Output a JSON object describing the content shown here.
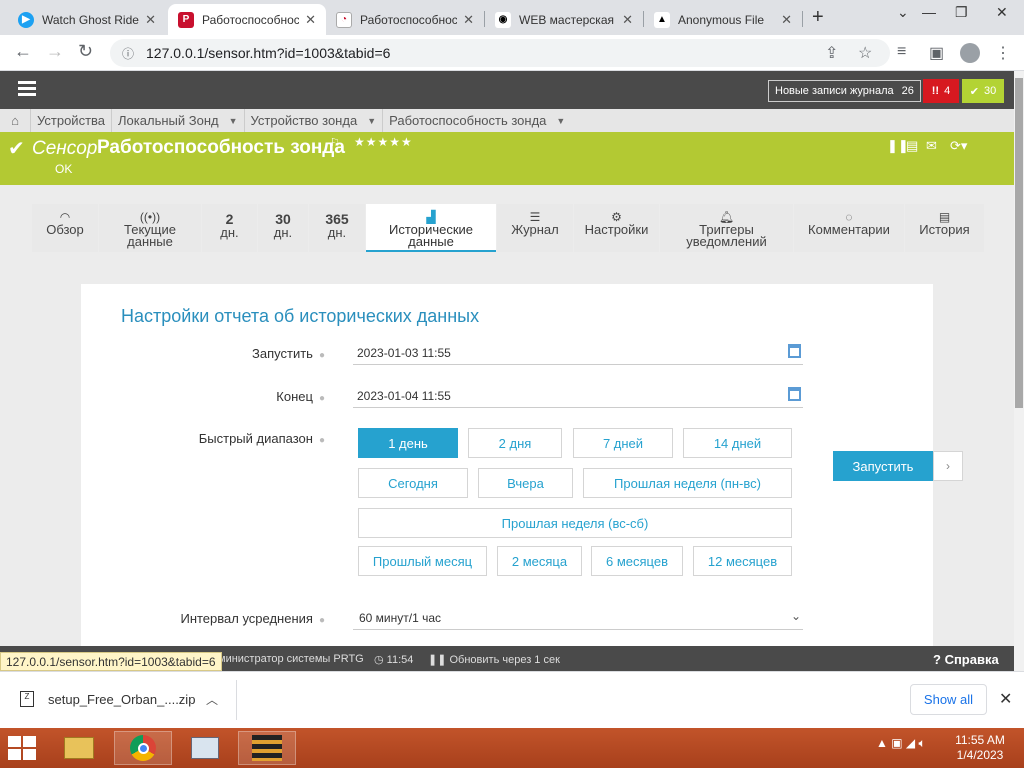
{
  "browser": {
    "tabs": [
      {
        "title": "Watch Ghost Rider",
        "active": false
      },
      {
        "title": "Работоспособность",
        "active": true
      },
      {
        "title": "Работоспособность",
        "active": false
      },
      {
        "title": "WEB мастерская",
        "active": false
      },
      {
        "title": "Anonymous File",
        "active": false
      }
    ],
    "url": "127.0.0.1/sensor.htm?id=1003&tabid=6"
  },
  "prtg": {
    "log_label": "Новые записи журнала",
    "log_count": "26",
    "error_count": "4",
    "ok_count": "30",
    "breadcrumb": [
      "Устройства",
      "Локальный Зонд",
      "Устройство зонда",
      "Работоспособность зонда"
    ],
    "sensor_type": "Сенсор",
    "sensor_name": "Работоспособность зонда",
    "status": "OK",
    "tabs": [
      {
        "label": "Обзор",
        "icon": "gauge-icon"
      },
      {
        "label": "Текущие данные",
        "icon": "live-data-icon"
      },
      {
        "big": "2",
        "label": "дн."
      },
      {
        "big": "30",
        "label": "дн."
      },
      {
        "big": "365",
        "label": "дн."
      },
      {
        "label": "Исторические данные",
        "icon": "chart-icon",
        "active": true
      },
      {
        "label": "Журнал",
        "icon": "log-icon"
      },
      {
        "label": "Настройки",
        "icon": "gear-icon"
      },
      {
        "label": "Триггеры уведомлений",
        "icon": "bell-icon"
      },
      {
        "label": "Комментарии",
        "icon": "comment-icon"
      },
      {
        "label": "История",
        "icon": "history-icon"
      }
    ],
    "report": {
      "title": "Настройки отчета об исторических данных",
      "start_label": "Запустить",
      "start_value": "2023-01-03 11:55",
      "end_label": "Конец",
      "end_value": "2023-01-04 11:55",
      "quick_label": "Быстрый диапазон",
      "quick_ranges": [
        "1 день",
        "2 дня",
        "7 дней",
        "14 дней",
        "Сегодня",
        "Вчера",
        "Прошлая неделя (пн-вс)",
        "Прошлая неделя (вс-сб)",
        "Прошлый месяц",
        "2 месяца",
        "6 месяцев",
        "12 месяцев"
      ],
      "selected_range": "1 день",
      "avg_label": "Интервал усреднения",
      "avg_value": "60 минут/1 час",
      "run_button": "Запустить"
    },
    "footer": {
      "status_url": "127.0.0.1/sensor.htm?id=1003&tabid=6",
      "user": "министратор системы PRTG",
      "time": "11:54",
      "refresh": "Обновить через 1 сек",
      "help": "Справка"
    }
  },
  "downloads": {
    "file": "setup_Free_Orban_....zip",
    "show_all": "Show all"
  },
  "taskbar": {
    "time": "11:55 AM",
    "date": "1/4/2023"
  }
}
